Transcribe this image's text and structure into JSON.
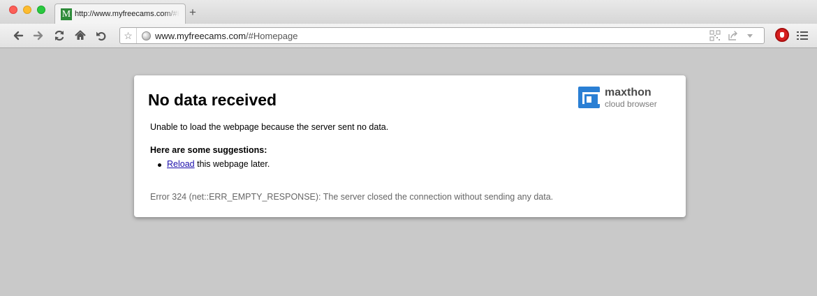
{
  "window": {
    "colors": {
      "close": "#fc5f57",
      "minimize": "#fdbc2f",
      "maximize": "#29c840"
    }
  },
  "tab": {
    "favicon_letter": "M",
    "title": "http://www.myfreecams.com/#Homepage",
    "new_tab_label": "+"
  },
  "toolbar": {
    "icons": [
      "back-icon",
      "forward-icon",
      "reload-icon",
      "home-icon",
      "undo-icon"
    ],
    "address": {
      "host": "www.myfreecams.com",
      "path": "/#Homepage"
    },
    "right_icons": [
      "qr-code-icon",
      "share-icon",
      "dropdown-arrow-icon",
      "adblock-icon",
      "menu-icon"
    ]
  },
  "error_page": {
    "title": "No data received",
    "message": "Unable to load the webpage because the server sent no data.",
    "suggestions_heading": "Here are some suggestions:",
    "suggestion": {
      "link_text": "Reload",
      "rest": " this webpage later."
    },
    "error_text": "Error 324 (net::ERR_EMPTY_RESPONSE): The server closed the connection without sending any data.",
    "logo": {
      "name": "maxthon",
      "tagline": "cloud browser",
      "color": "#2a7fd4"
    }
  }
}
